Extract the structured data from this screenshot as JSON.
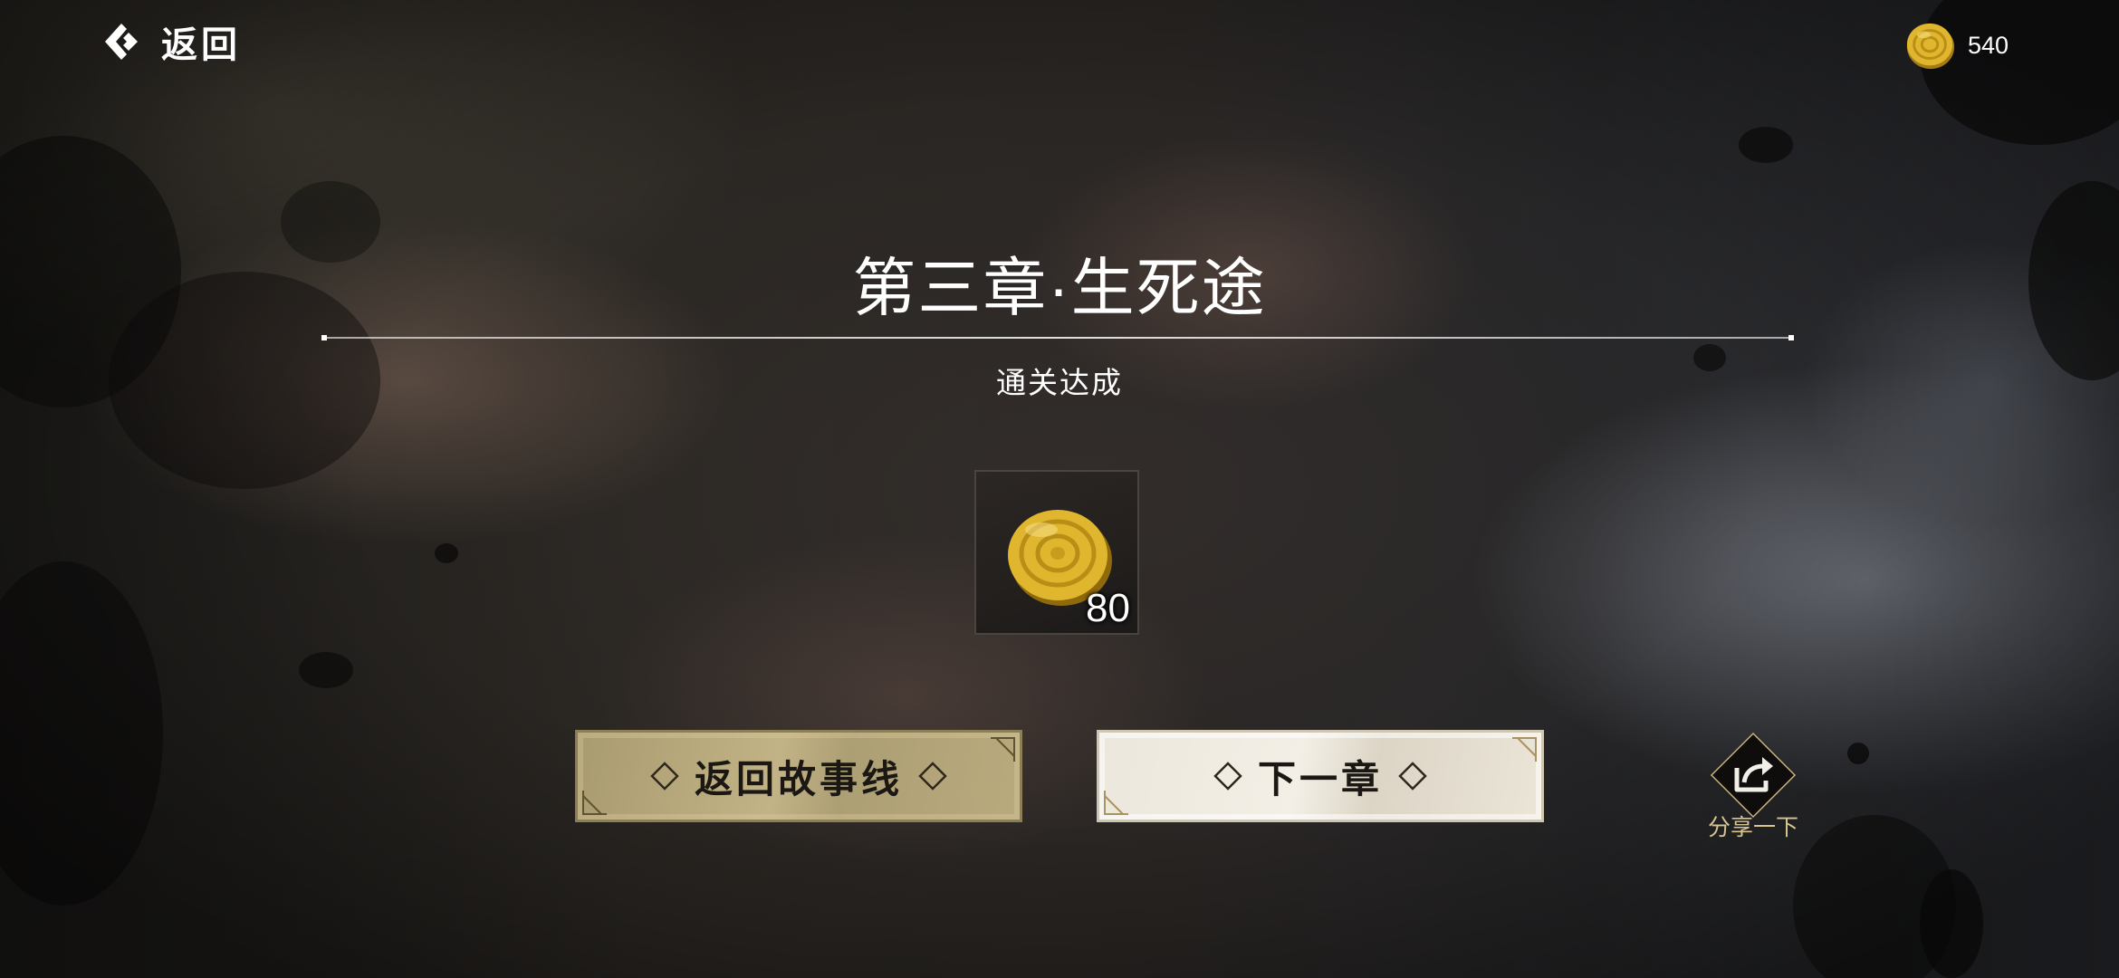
{
  "header": {
    "back_label": "返回",
    "currency": {
      "icon": "gold-coin-icon",
      "value": "540"
    }
  },
  "result": {
    "chapter_title": "第三章·生死途",
    "status": "通关达成"
  },
  "reward": {
    "icon": "gold-coin-icon",
    "count": "80"
  },
  "actions": {
    "return_story_label": "返回故事线",
    "next_chapter_label": "下一章",
    "share_label": "分享一下"
  },
  "colors": {
    "gold_button": "#b9aa7e",
    "light_button": "#ece7dc",
    "share_label": "#d8c58f",
    "coin_gold": "#e0b62e"
  }
}
